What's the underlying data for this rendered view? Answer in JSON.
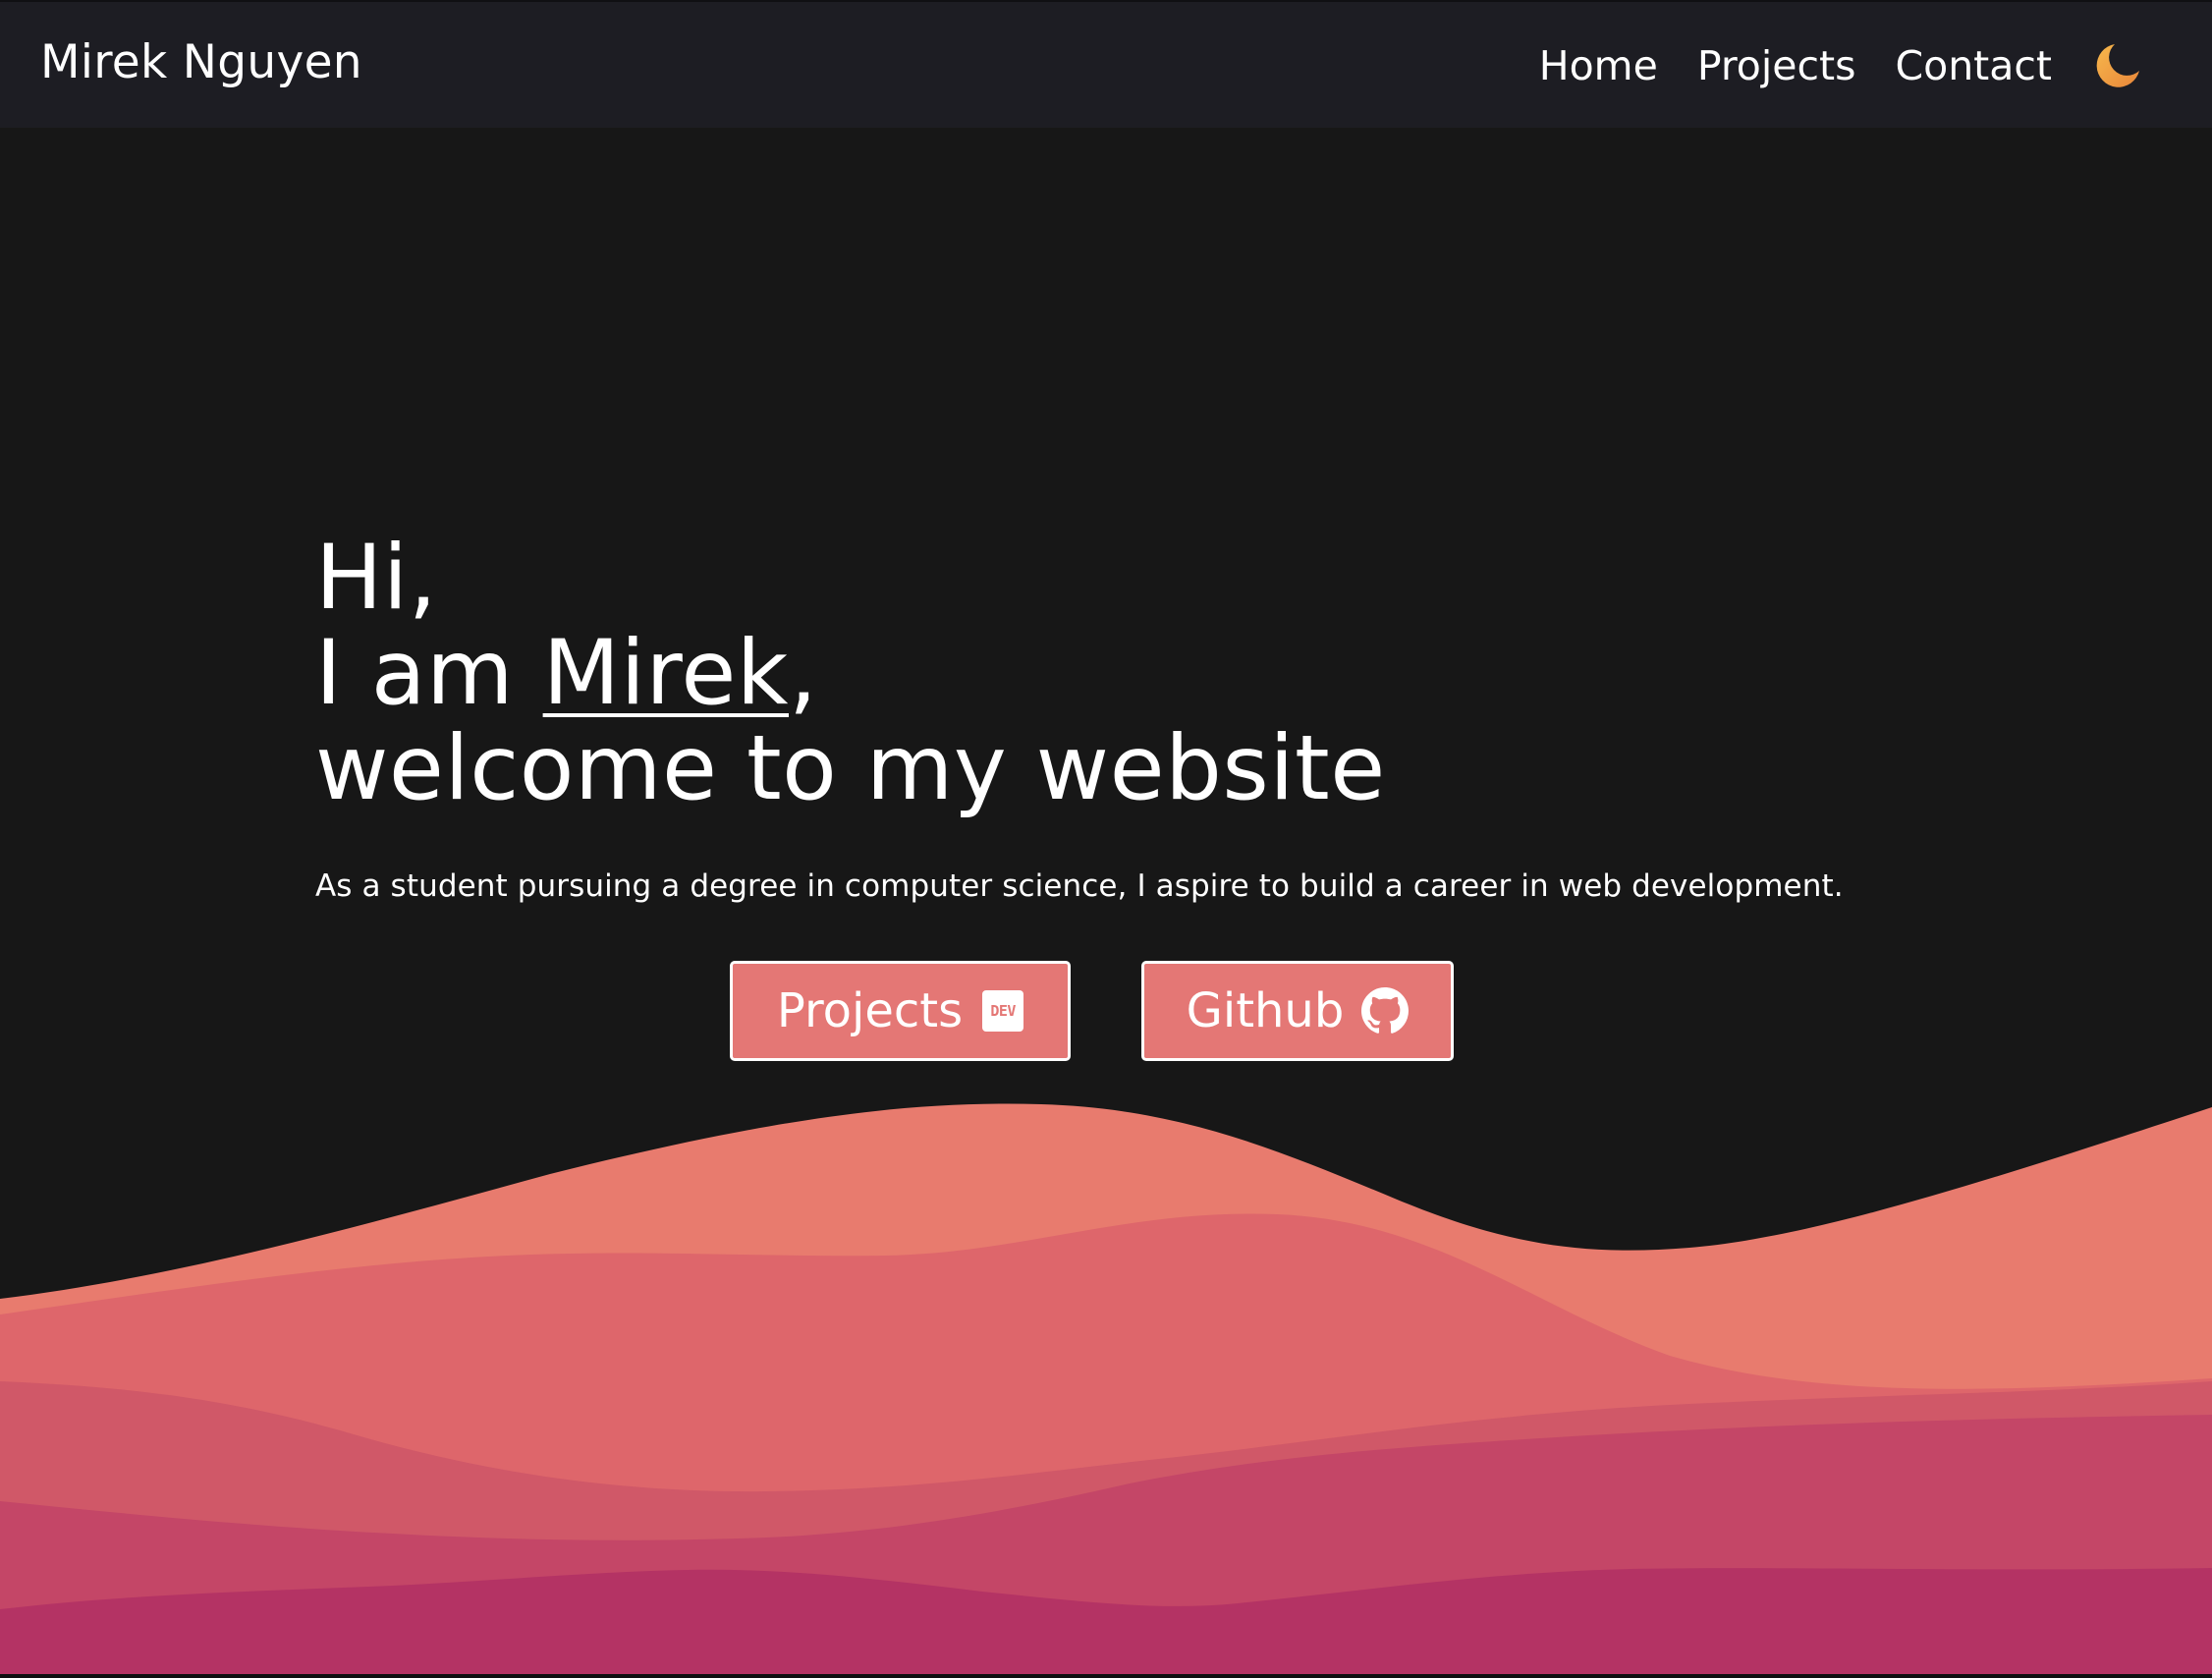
{
  "nav": {
    "brand": "Mirek Nguyen",
    "links": [
      {
        "label": "Home"
      },
      {
        "label": "Projects"
      },
      {
        "label": "Contact"
      }
    ],
    "theme_icon": "moon-icon"
  },
  "hero": {
    "line1": "Hi,",
    "line2_prefix": "I am ",
    "name": "Mirek",
    "line2_suffix": ",",
    "line3": "welcome to my website",
    "subtitle": "As a student pursuing a degree in computer science, I aspire to build a career in web development."
  },
  "buttons": {
    "projects_label": "Projects",
    "projects_icon": "dev-icon",
    "projects_icon_text": "DEV",
    "github_label": "Github",
    "github_icon": "github-icon"
  },
  "colors": {
    "background": "#171717",
    "navbar": "#1d1d23",
    "accent": "#e47775",
    "moon_gradient": [
      "#f5b04a",
      "#e8893a"
    ],
    "waves": [
      "#e87b6e",
      "#de666b",
      "#d05868",
      "#c44667",
      "#b43364"
    ]
  }
}
